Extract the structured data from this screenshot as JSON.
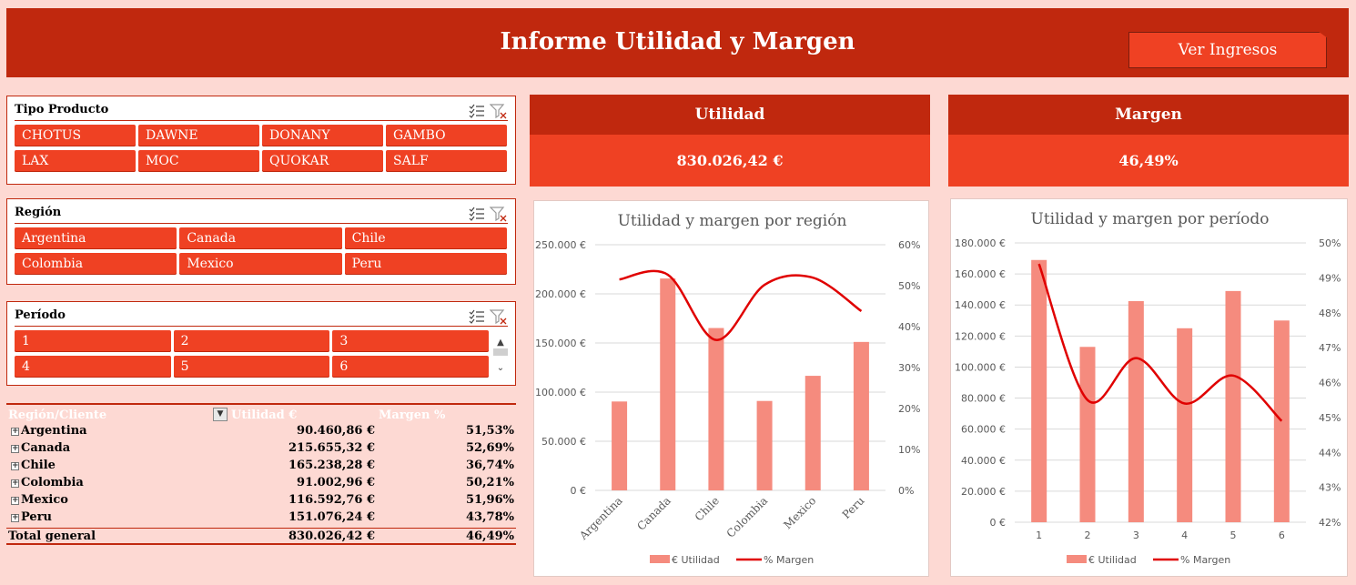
{
  "header": {
    "title": "Informe Utilidad y Margen",
    "button_label": "Ver Ingresos"
  },
  "slicers": {
    "tipo_producto": {
      "title": "Tipo Producto",
      "items": [
        "CHOTUS",
        "DAWNE",
        "DONANY",
        "GAMBO",
        "LAX",
        "MOC",
        "QUOKAR",
        "SALF"
      ]
    },
    "region": {
      "title": "Región",
      "items": [
        "Argentina",
        "Canada",
        "Chile",
        "Colombia",
        "Mexico",
        "Peru"
      ]
    },
    "periodo": {
      "title": "Período",
      "items": [
        "1",
        "2",
        "3",
        "4",
        "5",
        "6"
      ]
    }
  },
  "icons": {
    "multiselect": "multi-select-icon",
    "clear_filter": "clear-filter-icon",
    "expand": "expand-plus-icon",
    "dropdown": "dropdown-arrow-icon"
  },
  "kpis": {
    "utilidad": {
      "label": "Utilidad",
      "value": "830.026,42 €"
    },
    "margen": {
      "label": "Margen",
      "value": "46,49%"
    }
  },
  "pivot": {
    "headers": [
      "Región/Cliente",
      "Utilidad €",
      "Margen %"
    ],
    "rows": [
      {
        "label": "Argentina",
        "utilidad": "90.460,86 €",
        "margen": "51,53%"
      },
      {
        "label": "Canada",
        "utilidad": "215.655,32 €",
        "margen": "52,69%"
      },
      {
        "label": "Chile",
        "utilidad": "165.238,28 €",
        "margen": "36,74%"
      },
      {
        "label": "Colombia",
        "utilidad": "91.002,96 €",
        "margen": "50,21%"
      },
      {
        "label": "Mexico",
        "utilidad": "116.592,76 €",
        "margen": "51,96%"
      },
      {
        "label": "Peru",
        "utilidad": "151.076,24 €",
        "margen": "43,78%"
      }
    ],
    "total": {
      "label": "Total general",
      "utilidad": "830.026,42 €",
      "margen": "46,49%"
    }
  },
  "colors": {
    "dark_red": "#c0280e",
    "red": "#ef4123",
    "bar": "#f58b7e",
    "line": "#e00000",
    "background": "#fdd9d3"
  },
  "chart_data": [
    {
      "type": "bar",
      "title": "Utilidad y margen por región",
      "categories": [
        "Argentina",
        "Canada",
        "Chile",
        "Colombia",
        "Mexico",
        "Peru"
      ],
      "series": [
        {
          "name": "€ Utilidad",
          "type": "bar",
          "axis": "left",
          "values": [
            90460.86,
            215655.32,
            165238.28,
            91002.96,
            116592.76,
            151076.24
          ]
        },
        {
          "name": "% Margen",
          "type": "line",
          "axis": "right",
          "values": [
            51.53,
            52.69,
            36.74,
            50.21,
            51.96,
            43.78
          ]
        }
      ],
      "y_left": {
        "min": 0,
        "max": 250000,
        "ticks": [
          "0 €",
          "50.000 €",
          "100.000 €",
          "150.000 €",
          "200.000 €",
          "250.000 €"
        ]
      },
      "y_right": {
        "min": 0,
        "max": 60,
        "ticks": [
          "0%",
          "10%",
          "20%",
          "30%",
          "40%",
          "50%",
          "60%"
        ]
      },
      "legend": "bottom",
      "grid": true
    },
    {
      "type": "bar",
      "title": "Utilidad y margen por período",
      "categories": [
        "1",
        "2",
        "3",
        "4",
        "5",
        "6"
      ],
      "series": [
        {
          "name": "€ Utilidad",
          "type": "bar",
          "axis": "left",
          "values": [
            169000,
            113000,
            142500,
            125000,
            149000,
            130000
          ]
        },
        {
          "name": "% Margen",
          "type": "line",
          "axis": "right",
          "values": [
            49.4,
            45.5,
            46.7,
            45.4,
            46.2,
            44.9
          ]
        }
      ],
      "y_left": {
        "min": 0,
        "max": 180000,
        "ticks": [
          "0 €",
          "20.000 €",
          "40.000 €",
          "60.000 €",
          "80.000 €",
          "100.000 €",
          "120.000 €",
          "140.000 €",
          "160.000 €",
          "180.000 €"
        ]
      },
      "y_right": {
        "min": 42,
        "max": 50,
        "ticks": [
          "42%",
          "43%",
          "44%",
          "45%",
          "46%",
          "47%",
          "48%",
          "49%",
          "50%"
        ]
      },
      "legend": "bottom",
      "grid": true
    }
  ]
}
